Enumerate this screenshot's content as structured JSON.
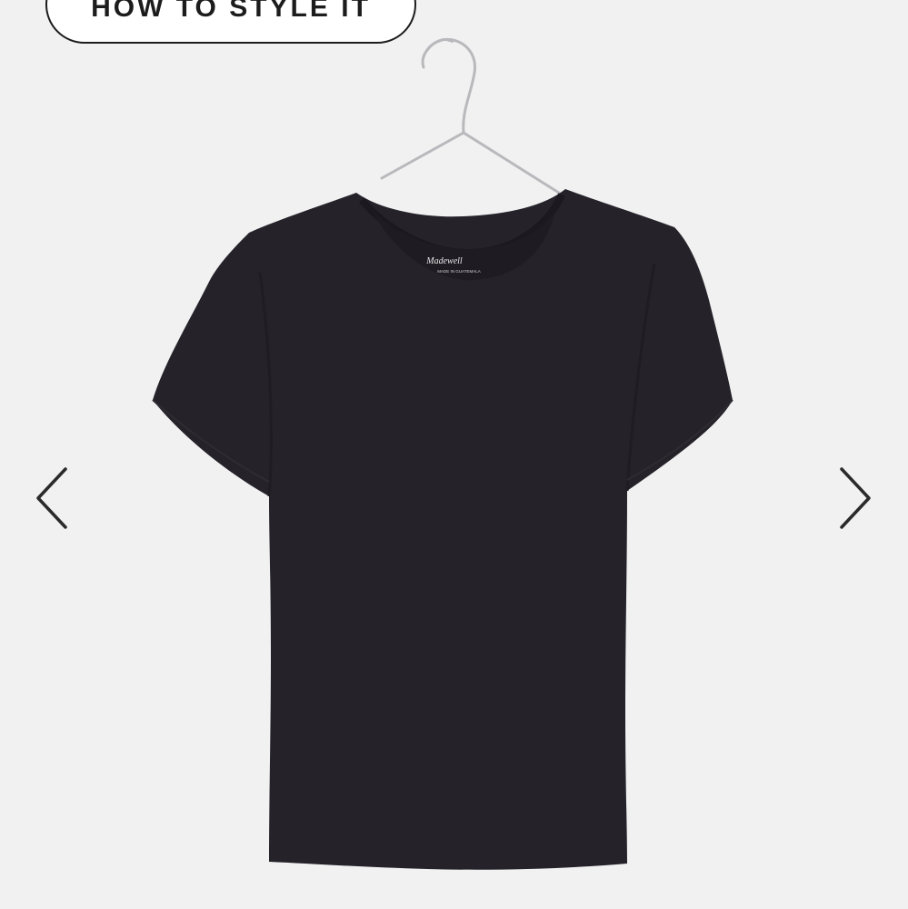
{
  "style_button": {
    "label": "HOW TO STYLE IT"
  },
  "product": {
    "brand_label": "Madewell",
    "label_subtext": "MADE IN GUATEMALA",
    "garment_color": "#25222a",
    "background_color": "#f1f1f1"
  },
  "carousel": {
    "prev_icon": "chevron-left-icon",
    "next_icon": "chevron-right-icon"
  }
}
